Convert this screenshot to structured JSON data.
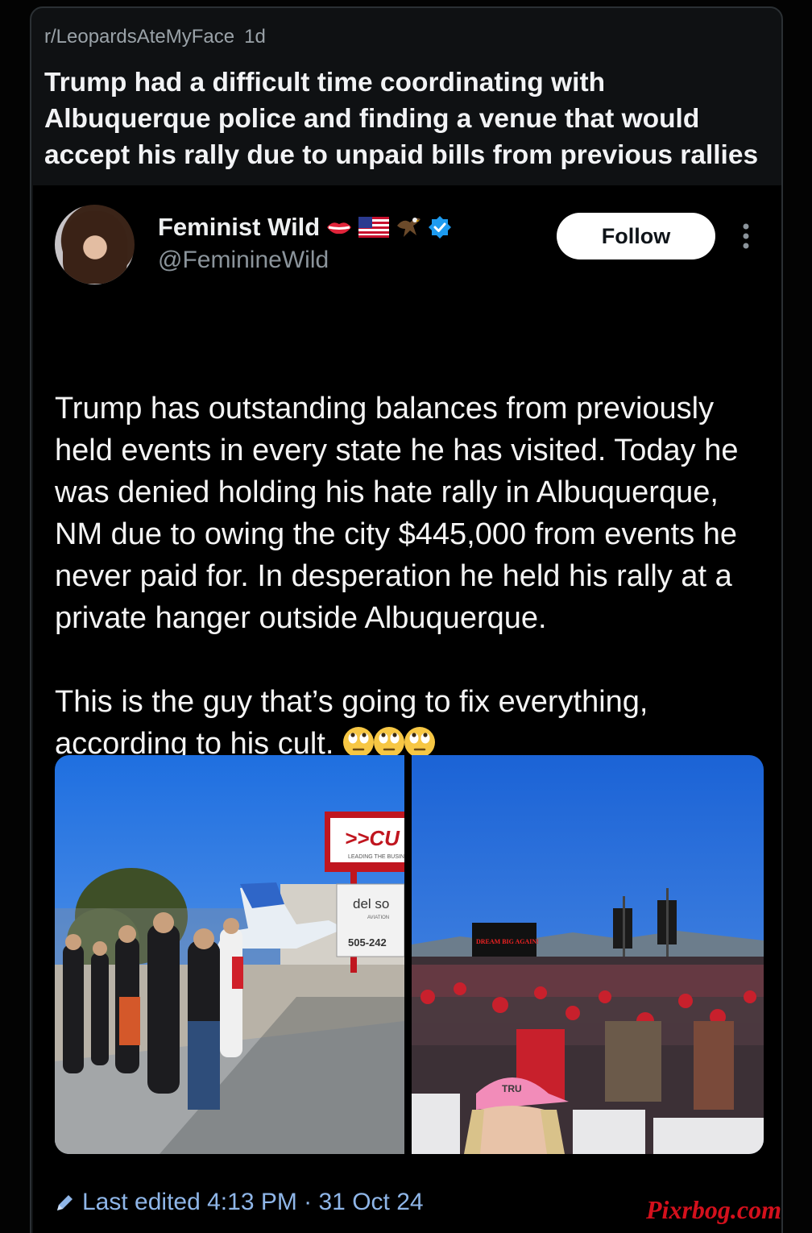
{
  "post": {
    "subreddit": "r/LeopardsAteMyFace",
    "age": "1d",
    "title": "Trump had a difficult time coordinating with Albuquerque police and finding a venue that would accept his rally due to unpaid bills from previous rallies"
  },
  "tweet": {
    "display_name": "Feminist Wild",
    "name_emojis": [
      "lips-icon",
      "us-flag-icon",
      "eagle-icon",
      "verified-badge-icon"
    ],
    "handle": "@FeminineWild",
    "follow_label": "Follow",
    "paragraph_1": "Trump has outstanding balances from previously held events in every state he has visited. Today he was denied holding his hate rally in Albuquerque, NM due to owing the city $445,000 from events he never paid for. In desperation he held his rally at a private hanger outside Albuquerque.",
    "paragraph_2": "This is the guy that’s going to fix everything, according to his cult.",
    "trailing_emojis": [
      "face-with-rolling-eyes-icon",
      "face-with-rolling-eyes-icon",
      "face-with-rolling-eyes-icon"
    ],
    "media": [
      {
        "alt_kind": "photo",
        "sign_text": ">>CU",
        "sign_sub": "LEADING THE BUSIN",
        "sign2_text": "del so",
        "sign2_sub": "AVIATION",
        "sign2_phone": "505-242"
      },
      {
        "alt_kind": "photo",
        "screen_text": "DREAM BIG AGAIN!",
        "hat_text": "TRU"
      }
    ],
    "footer": {
      "icon": "pencil-icon",
      "edited_label": "Last edited 4:13 PM · 31 Oct 24"
    }
  },
  "watermark": "Pixrbog.com",
  "colors": {
    "background": "#030303",
    "card": "#0f1113",
    "tweet_bg": "#000000",
    "verified": "#1d9bf0",
    "edited_link": "#8fb6e8",
    "watermark": "#d4101c"
  }
}
